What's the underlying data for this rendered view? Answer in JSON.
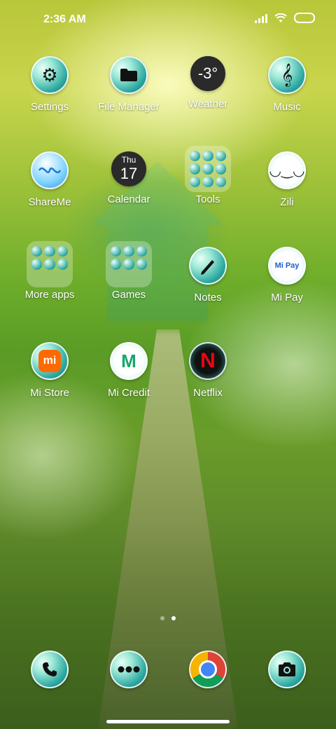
{
  "status_bar": {
    "time": "2:36 AM"
  },
  "weather": {
    "temp": "-3°"
  },
  "calendar": {
    "day": "Thu",
    "date": "17"
  },
  "apps": {
    "settings": "Settings",
    "file_manager": "File Manager",
    "weather": "Weather",
    "music": "Music",
    "shareme": "ShareMe",
    "calendar": "Calendar",
    "tools": "Tools",
    "zili": "Zili",
    "more_apps": "More apps",
    "games": "Games",
    "notes": "Notes",
    "mi_pay": "Mi Pay",
    "mi_store": "Mi Store",
    "mi_credit": "Mi Credit",
    "netflix": "Netflix"
  },
  "icon_text": {
    "mi_pay": "Mi Pay",
    "mi_credit": "M",
    "mi_store": "mi",
    "netflix": "N"
  },
  "pages": {
    "count": 2,
    "current": 2
  },
  "dock": [
    "phone-icon",
    "more-icon",
    "chrome-icon",
    "camera-icon"
  ],
  "colors": {
    "accent": "#2aa7a0",
    "netflix": "#e50914",
    "mi_orange": "#ff6a00"
  }
}
